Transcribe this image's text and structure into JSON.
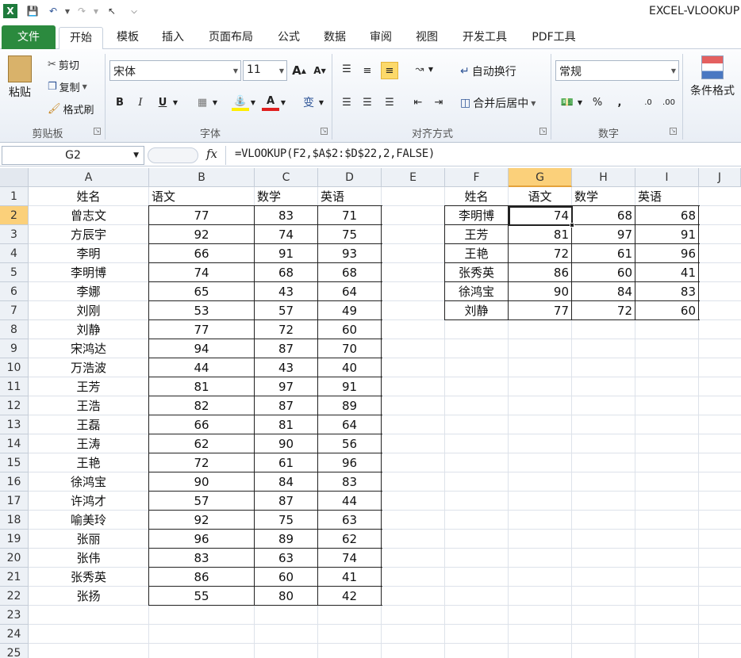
{
  "app_title": "EXCEL-VLOOKUP",
  "tabs": [
    "文件",
    "开始",
    "模板",
    "插入",
    "页面布局",
    "公式",
    "数据",
    "审阅",
    "视图",
    "开发工具",
    "PDF工具"
  ],
  "ribbon": {
    "clipboard": {
      "paste": "粘贴",
      "cut": "剪切",
      "copy": "复制",
      "format_painter": "格式刷",
      "label": "剪贴板"
    },
    "font": {
      "name": "宋体",
      "size": "11",
      "grow": "A",
      "shrink": "A",
      "bold": "B",
      "italic": "I",
      "underline": "U",
      "color_a": "A",
      "wen": "变",
      "label": "字体"
    },
    "alignment": {
      "wrap": "自动换行",
      "merge": "合并后居中",
      "label": "对齐方式"
    },
    "number": {
      "format": "常规",
      "percent": "%",
      "comma": ",",
      "inc": ".0",
      "dec": ".00",
      "label": "数字"
    },
    "styles": {
      "conditional": "条件格式"
    }
  },
  "formula_bar": {
    "name_box": "G2",
    "fx": "fx",
    "formula": "=VLOOKUP(F2,$A$2:$D$22,2,FALSE)"
  },
  "columns": [
    "A",
    "B",
    "C",
    "D",
    "E",
    "F",
    "G",
    "H",
    "I",
    "J"
  ],
  "rows": [
    "1",
    "2",
    "3",
    "4",
    "5",
    "6",
    "7",
    "8",
    "9",
    "10",
    "11",
    "12",
    "13",
    "14",
    "15",
    "16",
    "17",
    "18",
    "19",
    "20",
    "21",
    "22",
    "23",
    "24",
    "25"
  ],
  "table1": {
    "headers": [
      "姓名",
      "语文",
      "数学",
      "英语"
    ],
    "rows": [
      [
        "曾志文",
        "77",
        "83",
        "71"
      ],
      [
        "方辰宇",
        "92",
        "74",
        "75"
      ],
      [
        "李明",
        "66",
        "91",
        "93"
      ],
      [
        "李明博",
        "74",
        "68",
        "68"
      ],
      [
        "李娜",
        "65",
        "43",
        "64"
      ],
      [
        "刘刚",
        "53",
        "57",
        "49"
      ],
      [
        "刘静",
        "77",
        "72",
        "60"
      ],
      [
        "宋鸿达",
        "94",
        "87",
        "70"
      ],
      [
        "万浩波",
        "44",
        "43",
        "40"
      ],
      [
        "王芳",
        "81",
        "97",
        "91"
      ],
      [
        "王浩",
        "82",
        "87",
        "89"
      ],
      [
        "王磊",
        "66",
        "81",
        "64"
      ],
      [
        "王涛",
        "62",
        "90",
        "56"
      ],
      [
        "王艳",
        "72",
        "61",
        "96"
      ],
      [
        "徐鸿宝",
        "90",
        "84",
        "83"
      ],
      [
        "许鸿才",
        "57",
        "87",
        "44"
      ],
      [
        "喻美玲",
        "92",
        "75",
        "63"
      ],
      [
        "张丽",
        "96",
        "89",
        "62"
      ],
      [
        "张伟",
        "83",
        "63",
        "74"
      ],
      [
        "张秀英",
        "86",
        "60",
        "41"
      ],
      [
        "张扬",
        "55",
        "80",
        "42"
      ]
    ]
  },
  "table2": {
    "headers": [
      "姓名",
      "语文",
      "数学",
      "英语"
    ],
    "rows": [
      [
        "李明博",
        "74",
        "68",
        "68"
      ],
      [
        "王芳",
        "81",
        "97",
        "91"
      ],
      [
        "王艳",
        "72",
        "61",
        "96"
      ],
      [
        "张秀英",
        "86",
        "60",
        "41"
      ],
      [
        "徐鸿宝",
        "90",
        "84",
        "83"
      ],
      [
        "刘静",
        "77",
        "72",
        "60"
      ]
    ]
  }
}
